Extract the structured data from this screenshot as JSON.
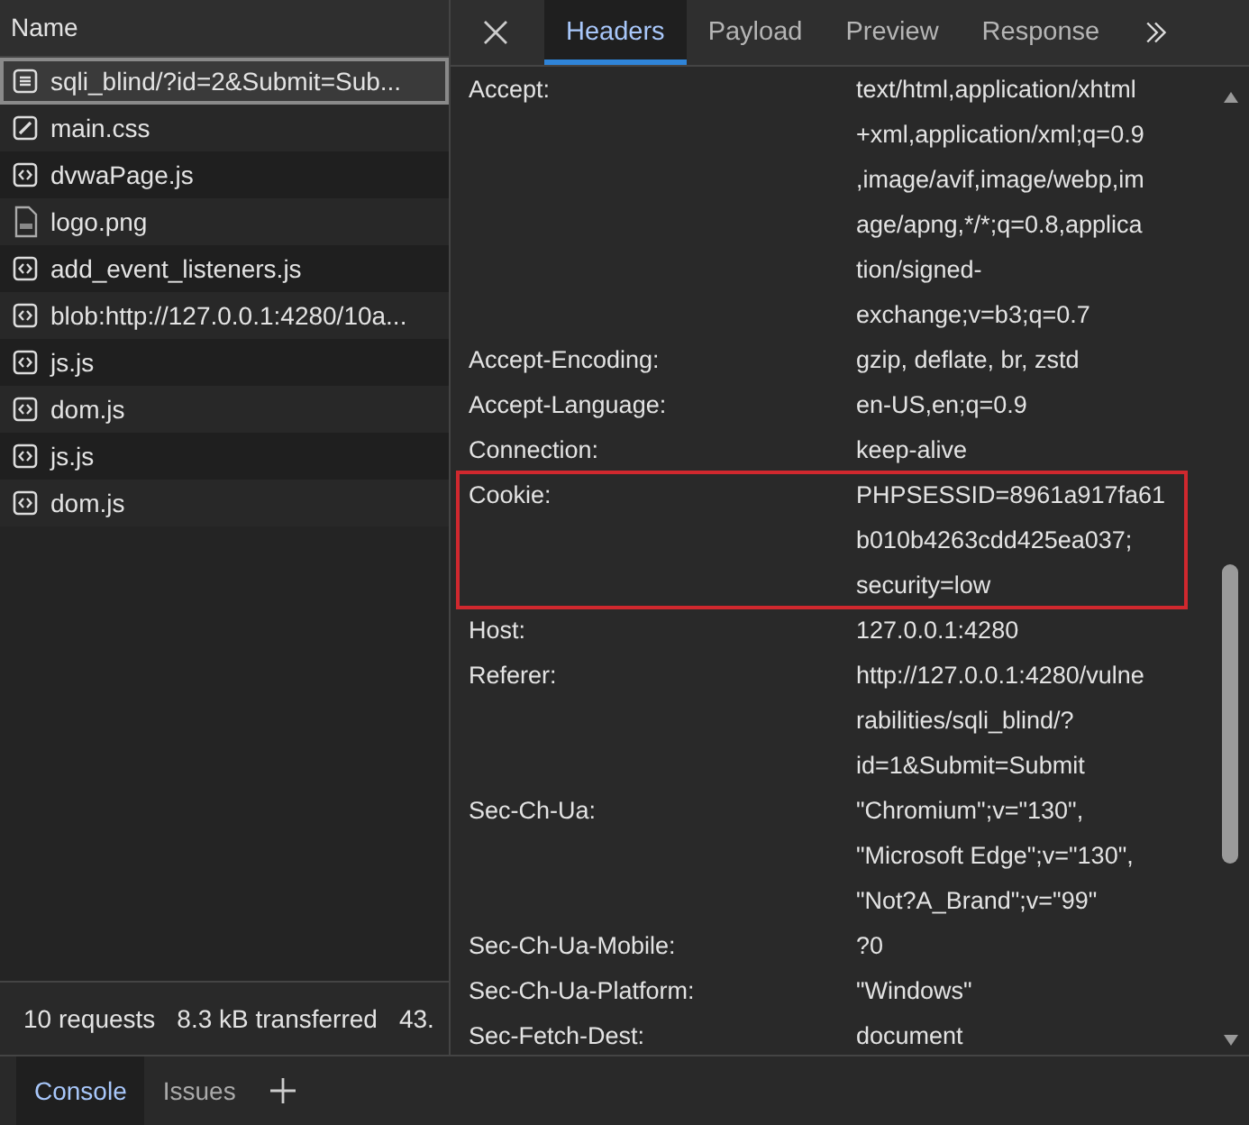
{
  "requests": {
    "column": "Name",
    "items": [
      {
        "kind": "document",
        "name": "sqli_blind/?id=2&Submit=Sub...",
        "selected": true
      },
      {
        "kind": "stylesheet",
        "name": "main.css",
        "selected": false
      },
      {
        "kind": "script",
        "name": "dvwaPage.js",
        "selected": false
      },
      {
        "kind": "image",
        "name": "logo.png",
        "selected": false
      },
      {
        "kind": "script",
        "name": "add_event_listeners.js",
        "selected": false
      },
      {
        "kind": "script",
        "name": "blob:http://127.0.0.1:4280/10a...",
        "selected": false
      },
      {
        "kind": "script",
        "name": "js.js",
        "selected": false
      },
      {
        "kind": "script",
        "name": "dom.js",
        "selected": false
      },
      {
        "kind": "script",
        "name": "js.js",
        "selected": false
      },
      {
        "kind": "script",
        "name": "dom.js",
        "selected": false
      }
    ],
    "summary": [
      "10 requests",
      "8.3 kB transferred",
      "43."
    ]
  },
  "detail": {
    "tabs": [
      {
        "label": "Headers",
        "selected": true
      },
      {
        "label": "Payload",
        "selected": false
      },
      {
        "label": "Preview",
        "selected": false
      },
      {
        "label": "Response",
        "selected": false
      }
    ],
    "headers": [
      {
        "name": "Accept:",
        "lines": [
          "text/html,application/xhtml",
          "+xml,application/xml;q=0.9",
          ",image/avif,image/webp,im",
          "age/apng,*/*;q=0.8,applica",
          "tion/signed-",
          "exchange;v=b3;q=0.7"
        ],
        "highlighted": false
      },
      {
        "name": "Accept-Encoding:",
        "lines": [
          "gzip, deflate, br, zstd"
        ],
        "highlighted": false
      },
      {
        "name": "Accept-Language:",
        "lines": [
          "en-US,en;q=0.9"
        ],
        "highlighted": false
      },
      {
        "name": "Connection:",
        "lines": [
          "keep-alive"
        ],
        "highlighted": false
      },
      {
        "name": "Cookie:",
        "lines": [
          "PHPSESSID=8961a917fa61",
          "b010b4263cdd425ea037;",
          "security=low"
        ],
        "highlighted": true
      },
      {
        "name": "Host:",
        "lines": [
          "127.0.0.1:4280"
        ],
        "highlighted": false
      },
      {
        "name": "Referer:",
        "lines": [
          "http://127.0.0.1:4280/vulne",
          "rabilities/sqli_blind/?",
          "id=1&Submit=Submit"
        ],
        "highlighted": false
      },
      {
        "name": "Sec-Ch-Ua:",
        "lines": [
          "\"Chromium\";v=\"130\",",
          "\"Microsoft Edge\";v=\"130\",",
          "\"Not?A_Brand\";v=\"99\""
        ],
        "highlighted": false
      },
      {
        "name": "Sec-Ch-Ua-Mobile:",
        "lines": [
          "?0"
        ],
        "highlighted": false
      },
      {
        "name": "Sec-Ch-Ua-Platform:",
        "lines": [
          "\"Windows\""
        ],
        "highlighted": false
      },
      {
        "name": "Sec-Fetch-Dest:",
        "lines": [
          "document"
        ],
        "highlighted": false
      }
    ]
  },
  "drawer": {
    "tabs": [
      {
        "label": "Console",
        "selected": true
      },
      {
        "label": "Issues",
        "selected": false
      }
    ]
  }
}
